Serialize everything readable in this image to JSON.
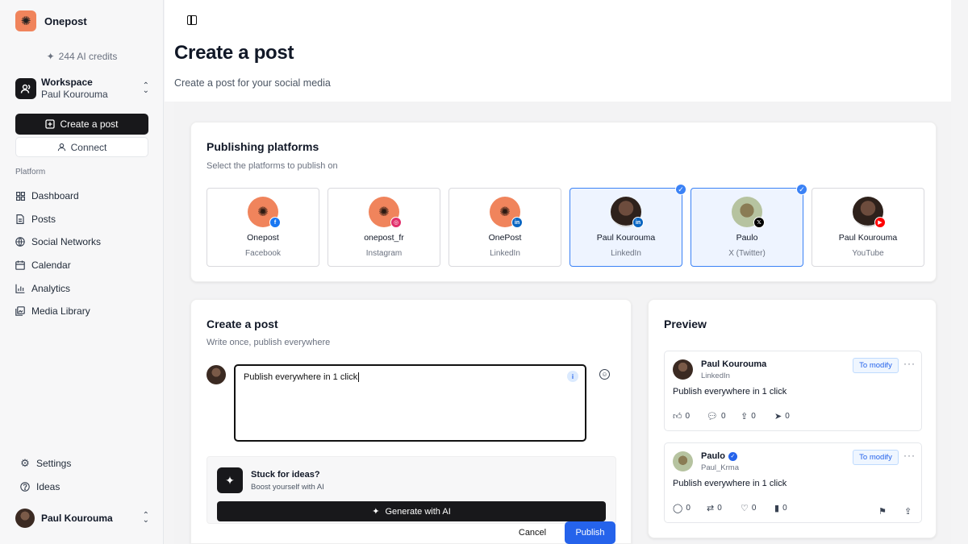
{
  "app": {
    "name": "Onepost"
  },
  "sidebar": {
    "credits": "244 AI credits",
    "workspace": {
      "title": "Workspace",
      "name": "Paul Kourouma"
    },
    "create_label": "Create a post",
    "connect_label": "Connect",
    "section_label": "Platform",
    "items": [
      {
        "label": "Dashboard",
        "icon": "grid-icon"
      },
      {
        "label": "Posts",
        "icon": "file-icon"
      },
      {
        "label": "Social Networks",
        "icon": "globe-icon"
      },
      {
        "label": "Calendar",
        "icon": "calendar-icon"
      },
      {
        "label": "Analytics",
        "icon": "bar-chart-icon"
      },
      {
        "label": "Media Library",
        "icon": "media-icon"
      }
    ],
    "bottom": [
      {
        "label": "Settings",
        "icon": "gear-icon"
      },
      {
        "label": "Ideas",
        "icon": "help-icon"
      }
    ],
    "user": "Paul Kourouma"
  },
  "page": {
    "title": "Create a post",
    "subtitle": "Create a post for your social media"
  },
  "platforms": {
    "title": "Publishing platforms",
    "subtitle": "Select the platforms to publish on",
    "accounts": [
      {
        "name": "Onepost",
        "network": "Facebook",
        "selected": false
      },
      {
        "name": "onepost_fr",
        "network": "Instagram",
        "selected": false
      },
      {
        "name": "OnePost",
        "network": "LinkedIn",
        "selected": false
      },
      {
        "name": "Paul Kourouma",
        "network": "LinkedIn",
        "selected": true
      },
      {
        "name": "Paulo",
        "network": "X (Twitter)",
        "selected": true
      },
      {
        "name": "Paul Kourouma",
        "network": "YouTube",
        "selected": false
      }
    ]
  },
  "composer": {
    "title": "Create a post",
    "subtitle": "Write once, publish everywhere",
    "text": "Publish everywhere in 1 click",
    "info_glyph": "i",
    "ideas_title": "Stuck for ideas?",
    "ideas_sub": "Boost yourself with AI",
    "generate_label": "Generate with AI",
    "cancel_label": "Cancel",
    "publish_label": "Publish"
  },
  "preview": {
    "title": "Preview",
    "linkedin": {
      "name": "Paul Kourouma",
      "network": "LinkedIn",
      "modify_label": "To modify",
      "text": "Publish everywhere in 1 click",
      "counts": {
        "like": "0",
        "comment": "0",
        "share": "0",
        "send": "0"
      }
    },
    "twitter": {
      "name": "Paulo",
      "handle": "Paul_Krma",
      "modify_label": "To modify",
      "text": "Publish everywhere in 1 click",
      "counts": {
        "reply": "0",
        "retweet": "0",
        "like": "0",
        "views": "0"
      }
    }
  },
  "colors": {
    "accent": "#2563eb",
    "brand": "#f0845c",
    "dark": "#18181b"
  }
}
